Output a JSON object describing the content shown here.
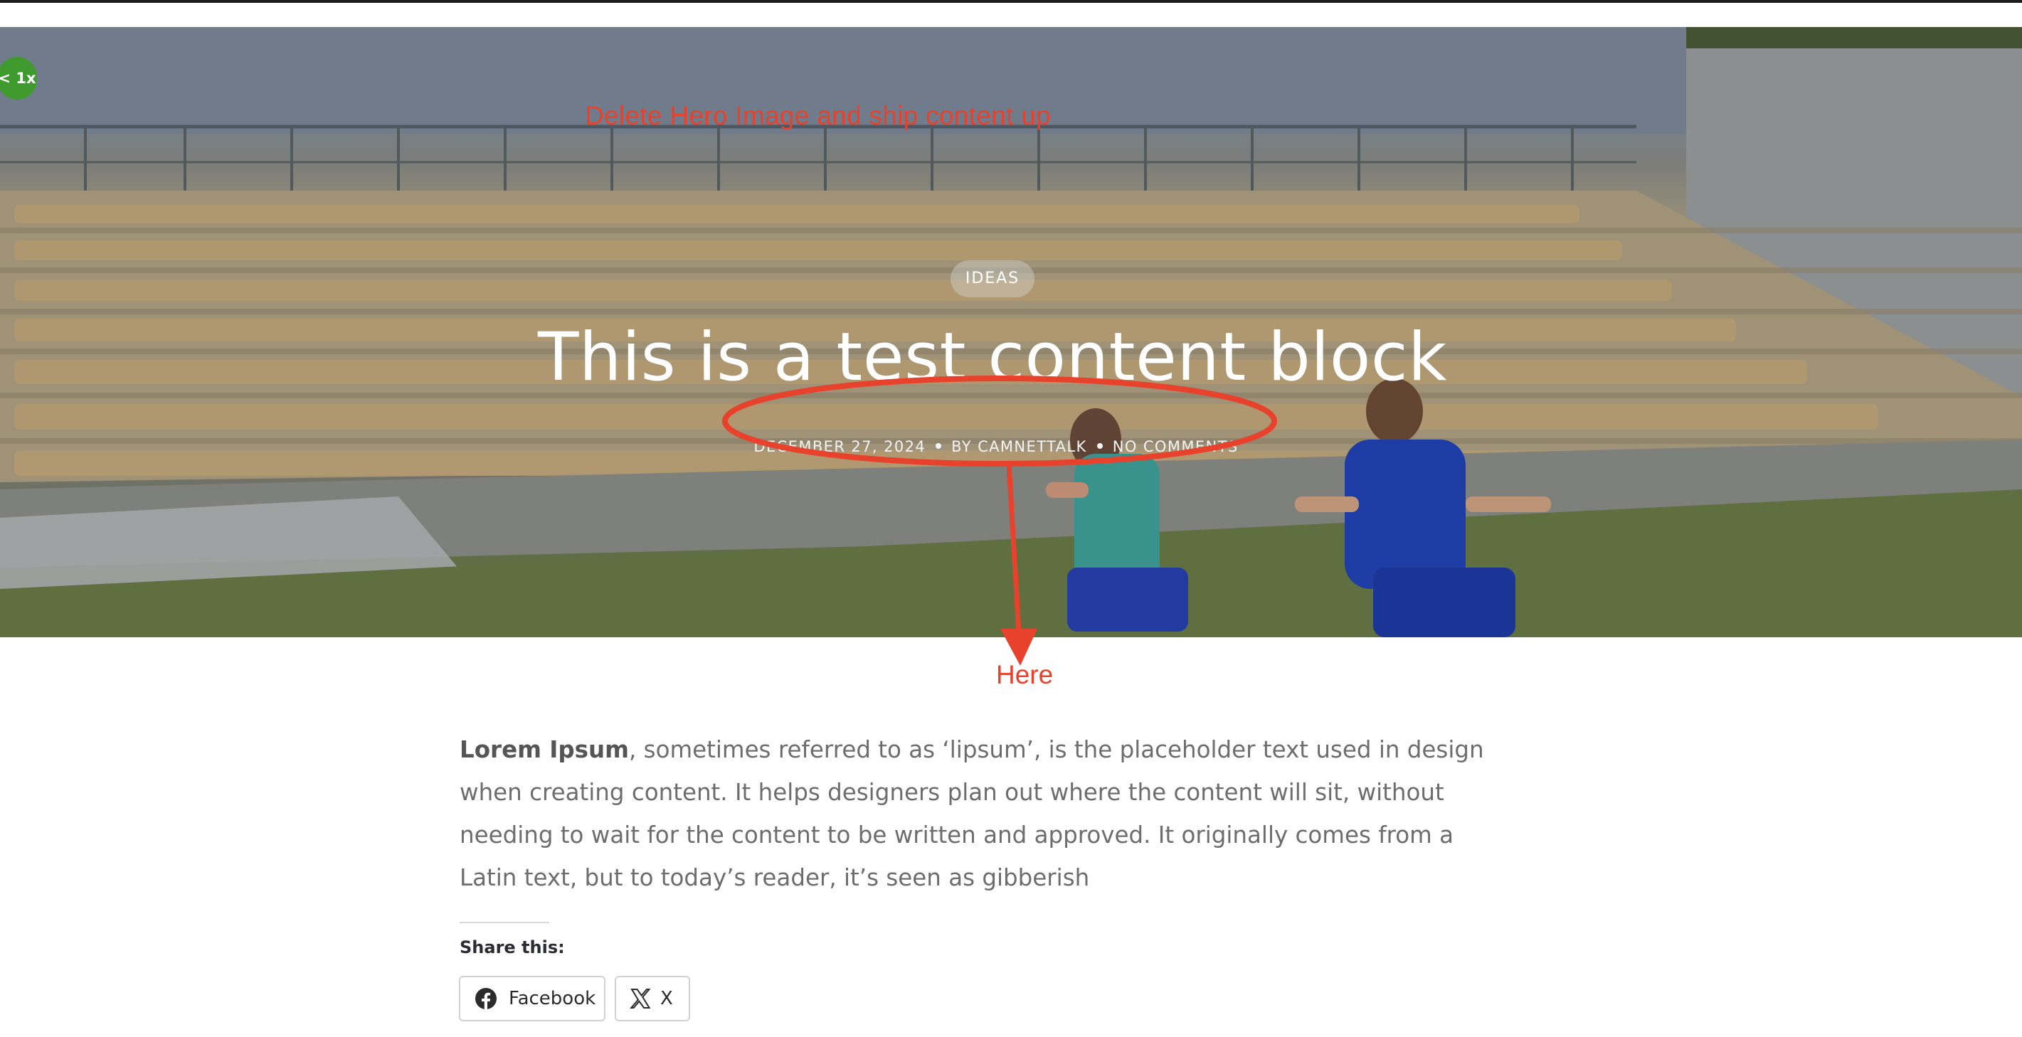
{
  "playback": {
    "speed_label": "< 1x"
  },
  "hero": {
    "category": "IDEAS",
    "title": "This is a test content block",
    "meta": {
      "date": "DECEMBER 27, 2024",
      "author": "BY CAMNETTALK",
      "comments": "NO COMMENTS"
    }
  },
  "annotations": {
    "note_top": "Delete Hero Image and ship content up",
    "note_here": "Here",
    "color": "#e8412c"
  },
  "article": {
    "lead_bold": "Lorem Ipsum",
    "lead_rest": ", sometimes referred to as ‘lipsum’, is the placeholder text used in design when creating content. It helps designers plan out where the content will sit, without needing to wait for the content to be written and approved. It originally comes from a Latin text, but to today’s reader, it’s seen as gibberish"
  },
  "share": {
    "label": "Share this:",
    "buttons": [
      {
        "label": "Facebook",
        "icon": "facebook-icon"
      },
      {
        "label": "X",
        "icon": "x-icon"
      }
    ]
  }
}
